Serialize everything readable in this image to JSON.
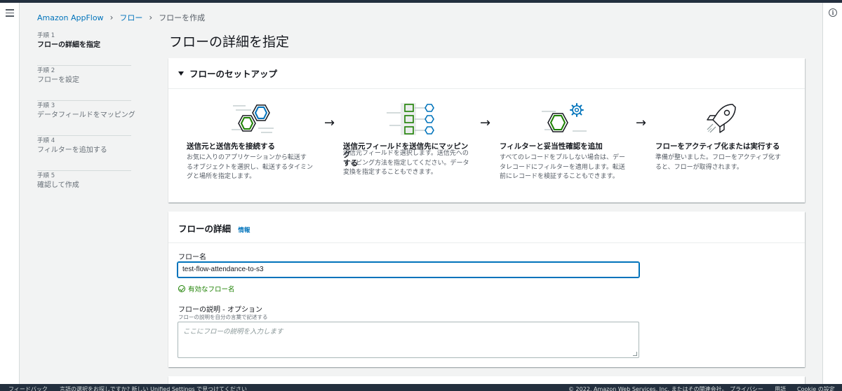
{
  "breadcrumb": {
    "root": "Amazon AppFlow",
    "flows": "フロー",
    "current": "フローを作成"
  },
  "steps": [
    {
      "num": "手順 1",
      "label": "フローの詳細を指定"
    },
    {
      "num": "手順 2",
      "label": "フローを設定"
    },
    {
      "num": "手順 3",
      "label": "データフィールドをマッピング"
    },
    {
      "num": "手順 4",
      "label": "フィルターを追加する"
    },
    {
      "num": "手順 5",
      "label": "確認して作成"
    }
  ],
  "page_title": "フローの詳細を指定",
  "setup": {
    "title": "フローのセットアップ",
    "arrow": "→",
    "stages": [
      {
        "icon": "connect-hexagons-icon",
        "title": "送信元と送信先を接続する",
        "desc": [
          "お気に入りのアプリケーションから転送す",
          "るオブジェクトを選択し、転送するタイミン",
          "グと場所を指定します。"
        ]
      },
      {
        "icon": "field-mapping-icon",
        "title": [
          "送信元フィールドを送信先にマッピング",
          "する"
        ],
        "desc": [
          "送信元フィールドを選択します。送信先への",
          "マッピング方法を指定してください。データ",
          "変換を指定することもできます。"
        ]
      },
      {
        "icon": "filter-validate-icon",
        "title": "フィルターと妥当性確認を追加",
        "desc": [
          "すべてのレコードをプルしない場合は、デー",
          "タレコードにフィルターを適用します。転送",
          "前にレコードを検証することもできます。"
        ]
      },
      {
        "icon": "rocket-icon",
        "title": "フローをアクティブ化または実行する",
        "desc": [
          "準備が整いました。フローをアクティブ化す",
          "ると、フローが取得されます。"
        ]
      }
    ]
  },
  "details": {
    "title": "フローの詳細",
    "info": "情報",
    "name_label": "フロー名",
    "name_value": "test-flow-attendance-to-s3",
    "valid_text": "有効なフロー名",
    "desc_label": "フローの説明 - オプション",
    "desc_sub": "フローの説明を自分の言葉で記述する",
    "desc_placeholder": "ここにフローの説明を入力します"
  },
  "footer": {
    "feedback": "フィードバック",
    "language_text": "言語の選択をお探しですか? 新しい Unified Settings で見つけてください",
    "copyright": "© 2022, Amazon Web Services, Inc. またはその関連会社。",
    "privacy": "プライバシー",
    "terms": "用語",
    "cookie": "Cookie の設定"
  },
  "colors": {
    "link": "#0073bb",
    "success": "#1d8102",
    "hex_green": "#1d8102",
    "hex_blue": "#0073bb",
    "dark_nav": "#232f3e"
  }
}
